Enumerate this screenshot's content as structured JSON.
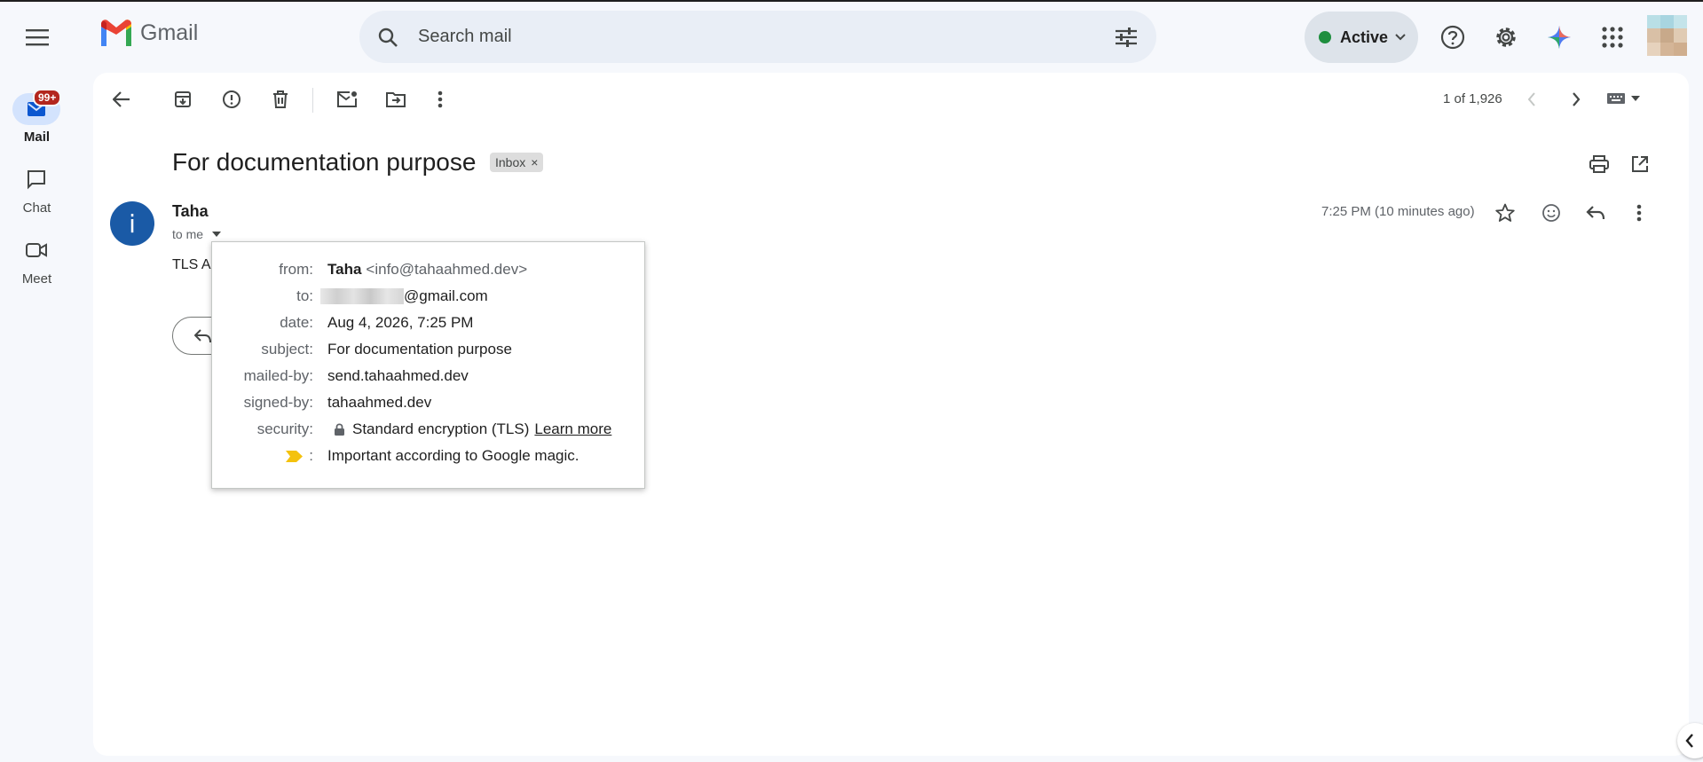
{
  "header": {
    "app_name": "Gmail",
    "search_placeholder": "Search mail",
    "status_label": "Active",
    "status_color": "#1e8e3e",
    "icons": [
      "main-menu-icon",
      "gmail-logo",
      "search-icon",
      "search-options-icon",
      "help-icon",
      "settings-icon",
      "gemini-icon",
      "apps-icon",
      "account-avatar"
    ]
  },
  "rail": {
    "items": [
      {
        "label": "Mail",
        "icon": "mail-icon",
        "badge": "99+"
      },
      {
        "label": "Chat",
        "icon": "chat-icon"
      },
      {
        "label": "Meet",
        "icon": "meet-icon"
      }
    ]
  },
  "toolbar": {
    "pager_text": "1 of 1,926",
    "icons": [
      "back-arrow-icon",
      "archive-icon",
      "report-spam-icon",
      "delete-icon",
      "mark-unread-icon",
      "move-to-icon",
      "more-icon",
      "newer-icon",
      "older-icon",
      "input-tools-icon"
    ]
  },
  "message": {
    "subject": "For documentation purpose",
    "label_chip": "Inbox",
    "label_remove": "×",
    "sender_initial": "i",
    "sender_name": "Taha",
    "recipient_summary": "to me",
    "timestamp": "7:25 PM (10 minutes ago)",
    "body_preview": "TLS A",
    "accent_color": "#1a5aa6"
  },
  "details": {
    "from_label": "from:",
    "from_name": "Taha",
    "from_email": "<info@tahaahmed.dev>",
    "to_label": "to:",
    "to_value": "@gmail.com",
    "date_label": "date:",
    "date_value": "Aug 4, 2026, 7:25 PM",
    "subject_label": "subject:",
    "subject_value": "For documentation purpose",
    "mailed_by_label": "mailed-by:",
    "mailed_by_value": "send.tahaahmed.dev",
    "signed_by_label": "signed-by:",
    "signed_by_value": "tahaahmed.dev",
    "security_label": "security:",
    "security_value": "Standard encryption (TLS)",
    "security_link": "Learn more",
    "importance_colon": ":",
    "importance_value": "Important according to Google magic.",
    "importance_color": "#f4c20d"
  }
}
